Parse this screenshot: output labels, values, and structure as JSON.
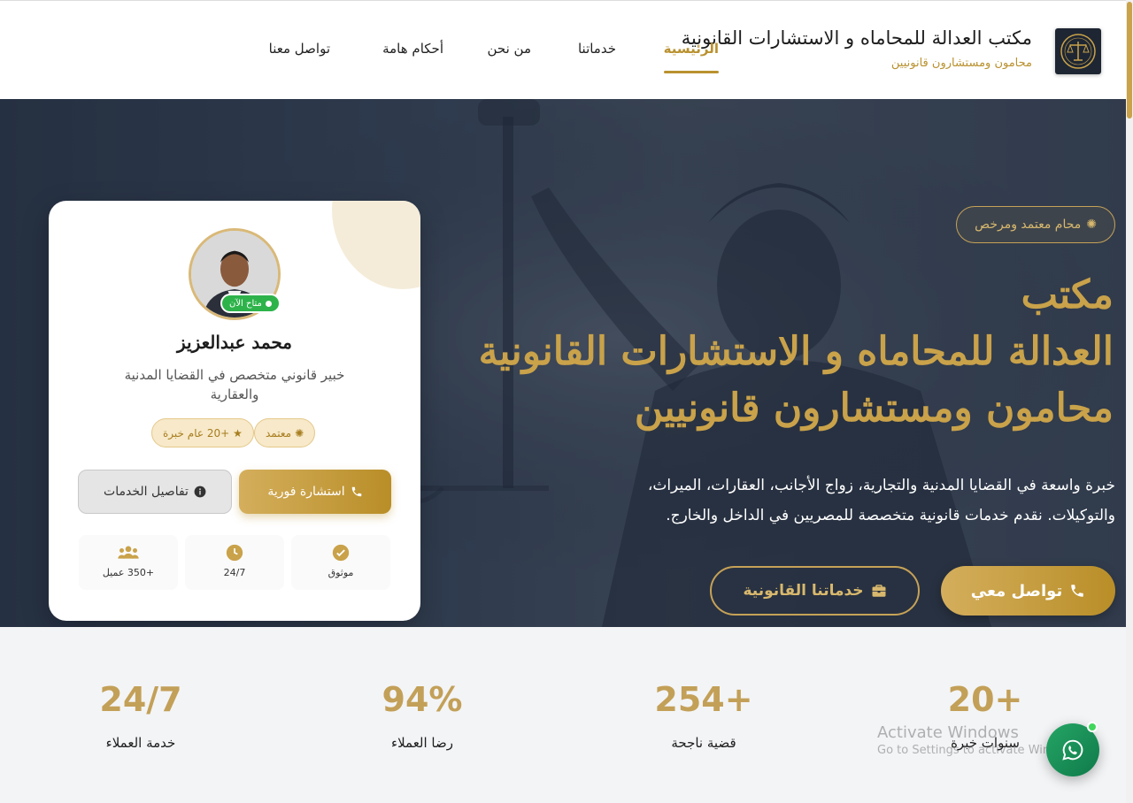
{
  "header": {
    "brand_title": "مكتب العدالة للمحاماه و الاستشارات القانونية",
    "brand_subtitle": "محامون ومستشارون قانونيين",
    "nav": [
      {
        "label": "الرئيسية",
        "active": true
      },
      {
        "label": "خدماتنا"
      },
      {
        "label": "من نحن"
      },
      {
        "label": "أحكام هامة"
      },
      {
        "label": "تواصل معنا"
      }
    ]
  },
  "hero": {
    "badge": "محام معتمد ومرخص",
    "title_line1": "مكتب",
    "title_line2": "العدالة للمحاماه و الاستشارات القانونية",
    "title_line3": "محامون ومستشارون قانونيين",
    "description": "خبرة واسعة في القضايا المدنية والتجارية، زواج الأجانب، العقارات، الميراث، والتوكيلات. نقدم خدمات قانونية متخصصة للمصريين في الداخل والخارج.",
    "btn_contact": "تواصل معي",
    "btn_services": "خدماتنا القانونية"
  },
  "profile": {
    "status": "متاح الآن",
    "name": "محمد عبدالعزيز",
    "role": "خبير قانوني متخصص في القضايا المدنية والعقارية",
    "chip_certified": "معتمد",
    "chip_experience": "+20 عام خبرة",
    "btn_consult": "استشارة فورية",
    "btn_details": "تفاصيل الخدمات",
    "features": [
      {
        "label": "موثوق",
        "icon": "check-circle-icon"
      },
      {
        "label": "24/7",
        "icon": "clock-icon"
      },
      {
        "label": "+350 عميل",
        "icon": "users-icon"
      }
    ]
  },
  "stats": [
    {
      "value": "+20",
      "label": "سنوات خبرة"
    },
    {
      "value": "+254",
      "label": "قضية ناجحة"
    },
    {
      "value": "94%",
      "label": "رضا العملاء"
    },
    {
      "value": "24/7",
      "label": "خدمة العملاء"
    }
  ],
  "watermark": {
    "line1": "Activate Windows",
    "line2": "Go to Settings to activate Windows."
  },
  "colors": {
    "gold": "#c9a24a",
    "navy": "#2a3547",
    "online_green": "#2db34a",
    "whatsapp": "#25a565"
  }
}
